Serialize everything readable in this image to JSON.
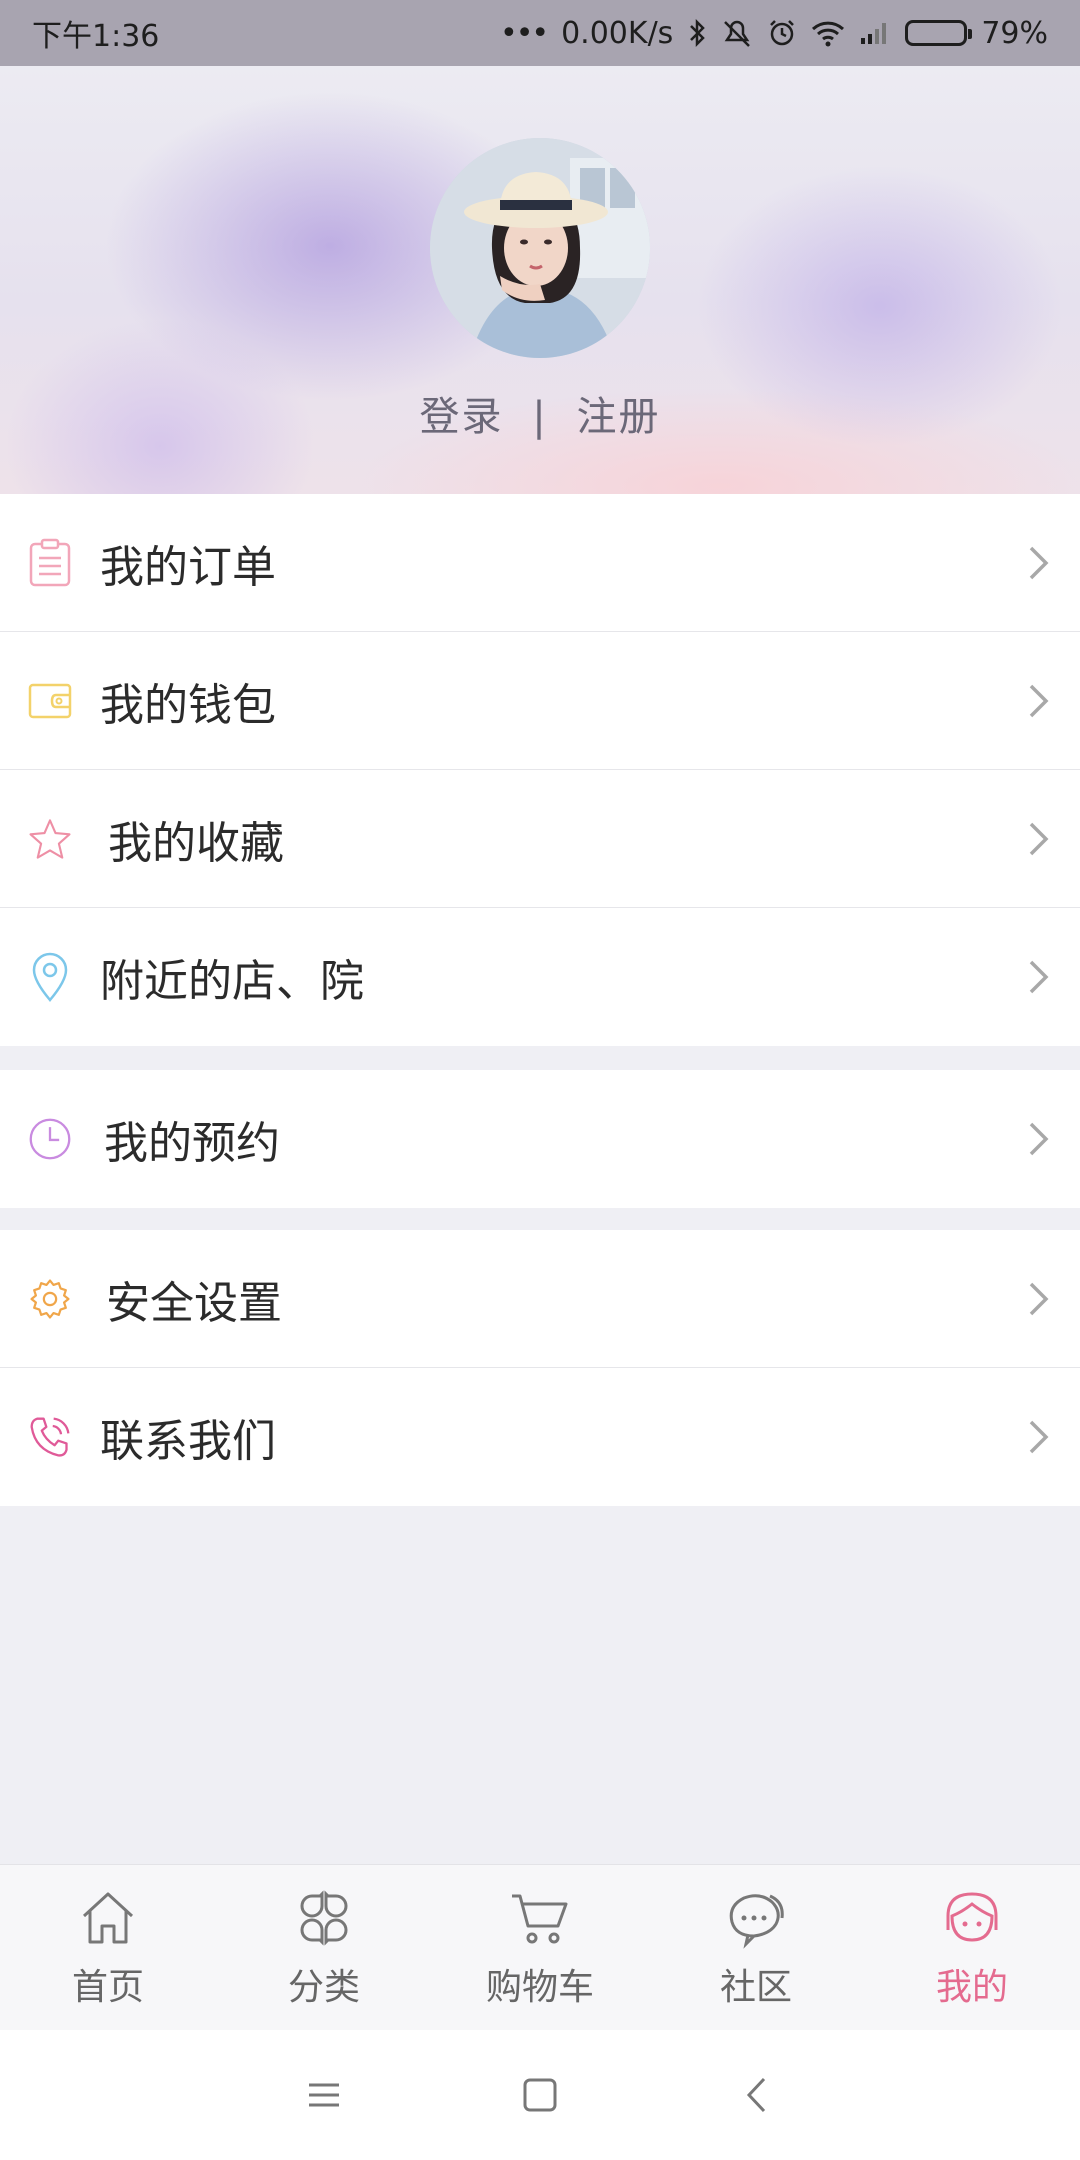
{
  "status_bar": {
    "time": "下午1:36",
    "network_speed": "0.00K/s",
    "battery": "79%",
    "battery_level": 0.79
  },
  "header": {
    "login": "登录",
    "separator": "|",
    "register": "注册"
  },
  "menu": {
    "group1": [
      {
        "label": "我的订单",
        "icon": "order-list-icon"
      },
      {
        "label": "我的钱包",
        "icon": "wallet-icon"
      },
      {
        "label": "我的收藏",
        "icon": "star-icon"
      },
      {
        "label": "附近的店、院",
        "icon": "location-pin-icon"
      }
    ],
    "group2": [
      {
        "label": "我的预约",
        "icon": "clock-icon"
      }
    ],
    "group3": [
      {
        "label": "安全设置",
        "icon": "gear-icon"
      },
      {
        "label": "联系我们",
        "icon": "phone-icon"
      }
    ]
  },
  "tabbar": {
    "tabs": [
      {
        "label": "首页",
        "icon": "home-icon"
      },
      {
        "label": "分类",
        "icon": "category-icon"
      },
      {
        "label": "购物车",
        "icon": "cart-icon"
      },
      {
        "label": "社区",
        "icon": "chat-icon"
      },
      {
        "label": "我的",
        "icon": "profile-icon",
        "active": true
      }
    ],
    "active_color": "#e46b8f",
    "inactive_color": "#666666"
  },
  "colors": {
    "order": "#f2a6b9",
    "wallet": "#f3d26a",
    "star": "#ee8fa5",
    "location": "#7cc7ea",
    "clock": "#c98be0",
    "gear": "#f0a64a",
    "phone": "#e05a98"
  }
}
